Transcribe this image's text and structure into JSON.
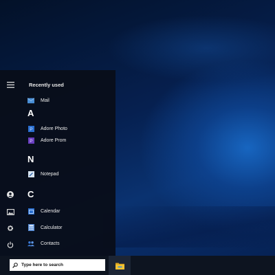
{
  "start_menu": {
    "section_title": "Recently used",
    "rail": {
      "menu_icon": "hamburger-menu-icon",
      "user_icon": "user-icon",
      "pictures_icon": "pictures-icon",
      "settings_icon": "gear-icon",
      "power_icon": "power-icon"
    },
    "recent": [
      {
        "label": "Mail",
        "icon": "mail-icon",
        "color": "#4a8fd6"
      }
    ],
    "groups": [
      {
        "letter": "A",
        "apps": [
          {
            "label": "Adore Photo",
            "icon": "adore-photo-icon",
            "color": "#2a6fd0"
          },
          {
            "label": "Adore Prom",
            "icon": "adore-prom-icon",
            "color": "#6a3fc0"
          }
        ]
      },
      {
        "letter": "N",
        "apps": [
          {
            "label": "Notepad",
            "icon": "notepad-icon",
            "color": "#d8e4f0"
          }
        ]
      },
      {
        "letter": "C",
        "apps": [
          {
            "label": "Calendar",
            "icon": "calendar-icon",
            "color": "#2a6fd0"
          },
          {
            "label": "Calculator",
            "icon": "calculator-icon",
            "color": "#5a8fd8"
          },
          {
            "label": "Contacts",
            "icon": "contacts-icon",
            "color": "#3a7ad8"
          }
        ]
      }
    ]
  },
  "taskbar": {
    "search_placeholder": "Type here to search",
    "search_icon": "search-icon",
    "pinned_app_icon": "file-explorer-icon",
    "pinned_app_color": "#f2c232"
  }
}
